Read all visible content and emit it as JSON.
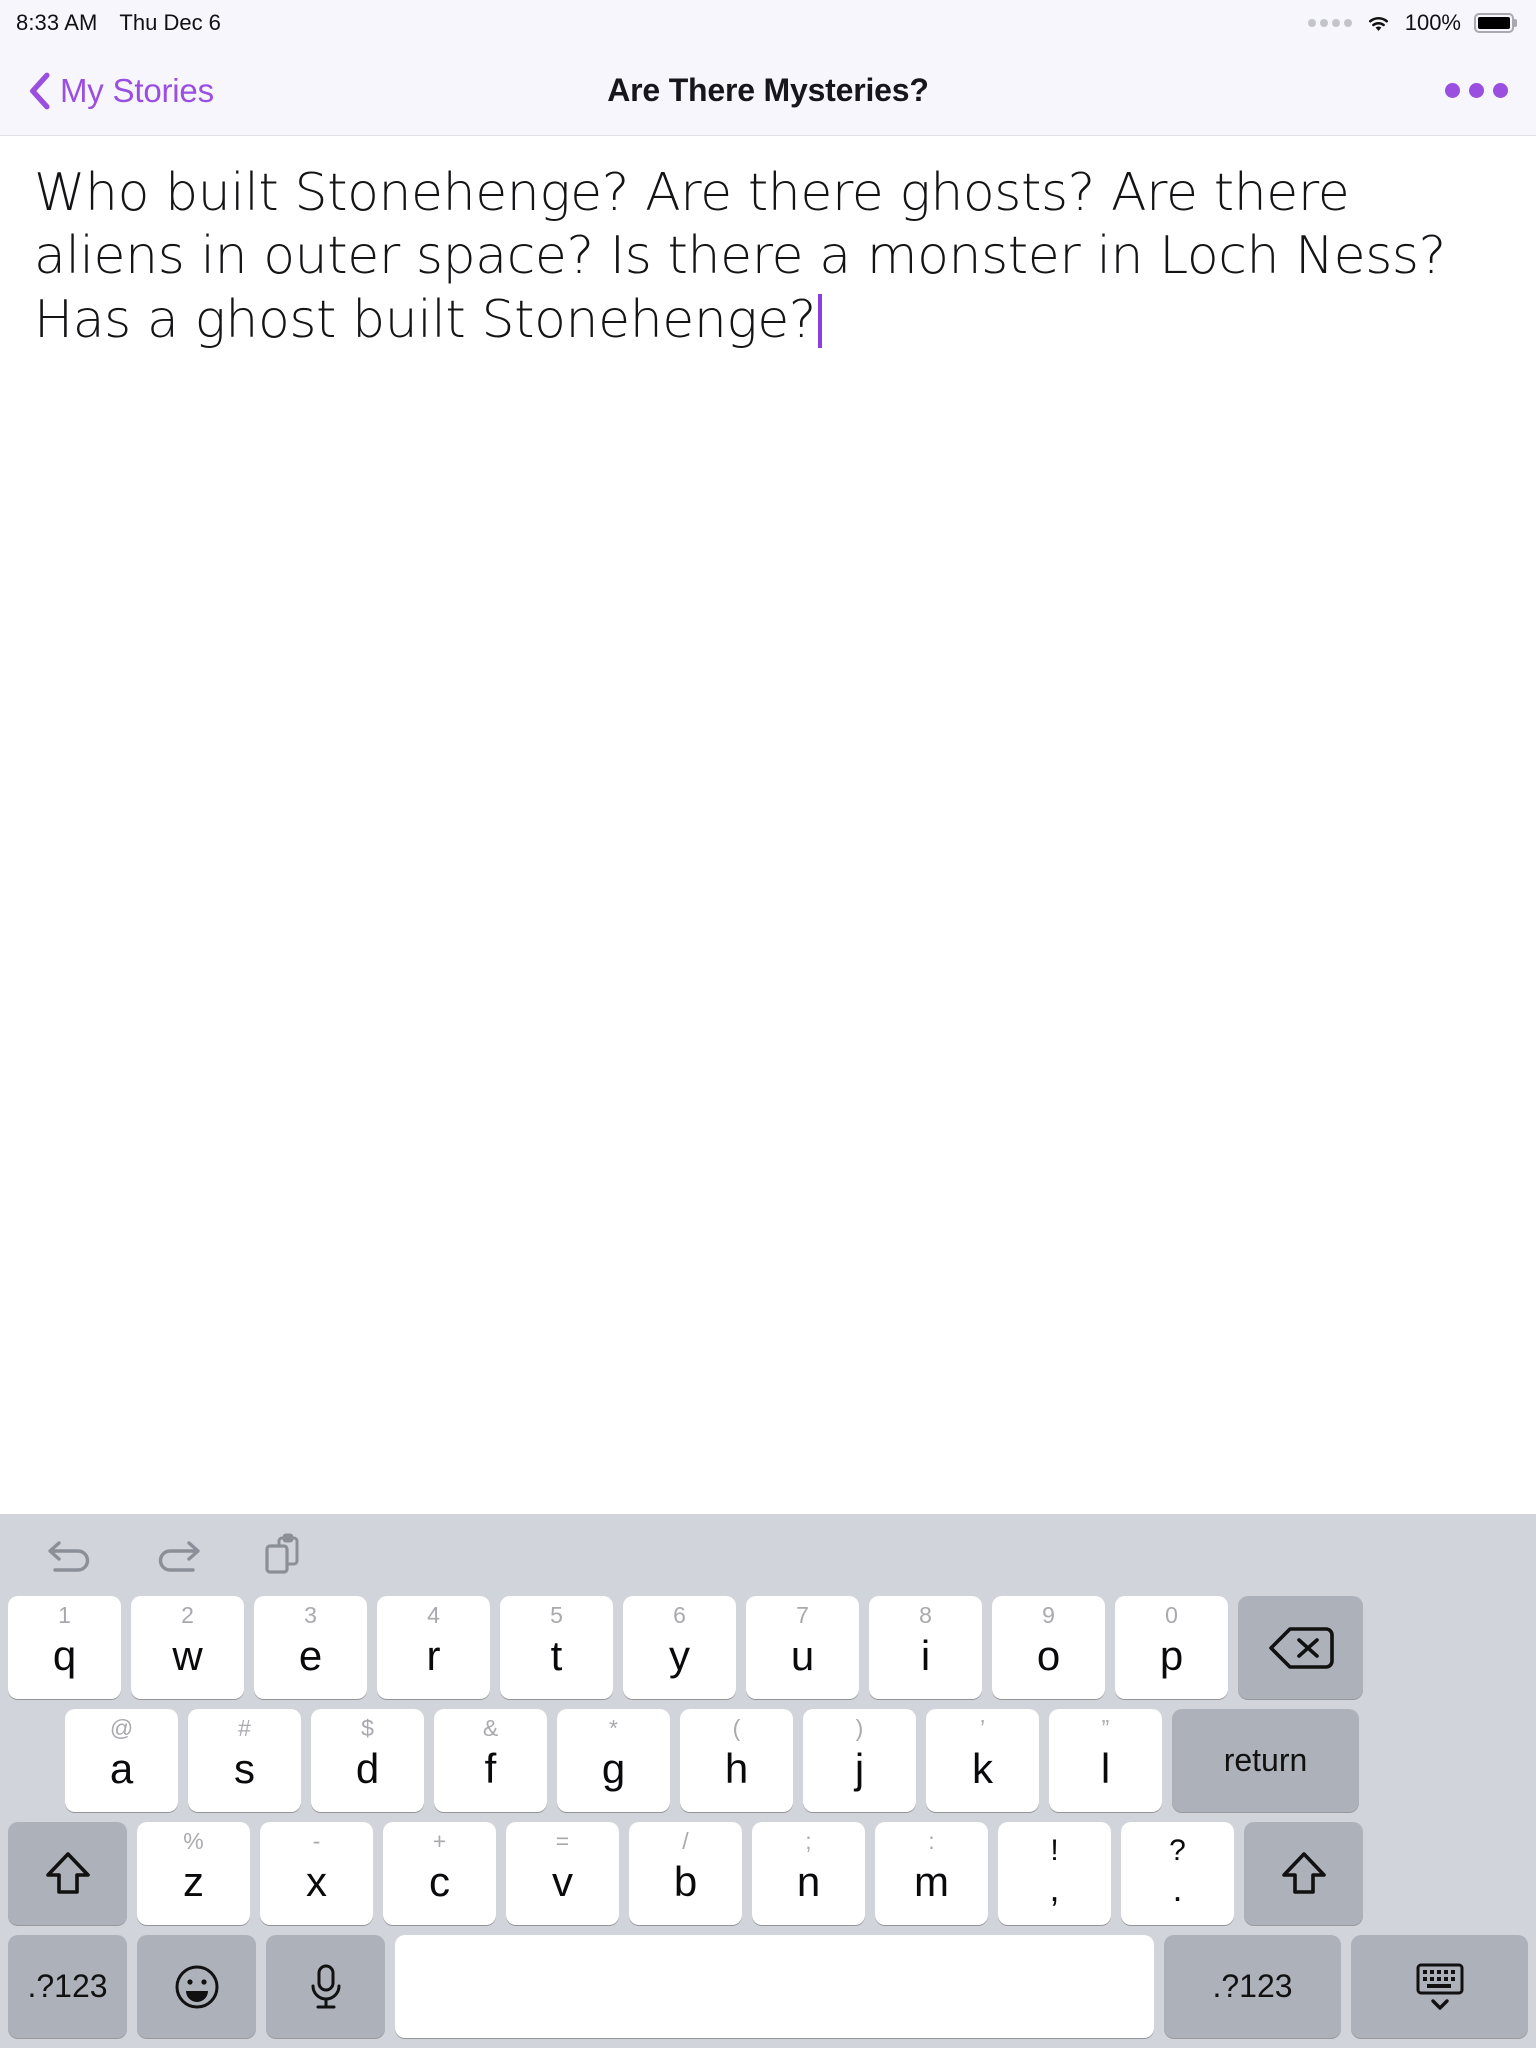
{
  "status_bar": {
    "time": "8:33 AM",
    "date": "Thu Dec 6",
    "battery_percent": "100%",
    "signal_icon": "signal-dots-icon",
    "wifi_icon": "wifi-icon",
    "battery_icon": "battery-full-icon"
  },
  "nav_bar": {
    "back_label": "My Stories",
    "back_icon": "chevron-left-icon",
    "title": "Are There Mysteries?",
    "more_icon": "more-horizontal-icon",
    "accent_color": "#9a4fe0"
  },
  "editor": {
    "story_text": "Who built Stonehenge? Are there ghosts? Are there aliens in outer space? Is there a monster in Loch Ness? Has a ghost built Stonehenge?",
    "caret_color": "#8b3fe0"
  },
  "keyboard": {
    "toolbar": [
      {
        "name": "undo-icon",
        "label": "undo"
      },
      {
        "name": "redo-icon",
        "label": "redo"
      },
      {
        "name": "paste-icon",
        "label": "paste"
      }
    ],
    "row1": [
      {
        "sub": "1",
        "main": "q"
      },
      {
        "sub": "2",
        "main": "w"
      },
      {
        "sub": "3",
        "main": "e"
      },
      {
        "sub": "4",
        "main": "r"
      },
      {
        "sub": "5",
        "main": "t"
      },
      {
        "sub": "6",
        "main": "y"
      },
      {
        "sub": "7",
        "main": "u"
      },
      {
        "sub": "8",
        "main": "i"
      },
      {
        "sub": "9",
        "main": "o"
      },
      {
        "sub": "0",
        "main": "p"
      }
    ],
    "backspace_icon": "backspace-icon",
    "row2": [
      {
        "sub": "@",
        "main": "a"
      },
      {
        "sub": "#",
        "main": "s"
      },
      {
        "sub": "$",
        "main": "d"
      },
      {
        "sub": "&",
        "main": "f"
      },
      {
        "sub": "*",
        "main": "g"
      },
      {
        "sub": "(",
        "main": "h"
      },
      {
        "sub": ")",
        "main": "j"
      },
      {
        "sub": "’",
        "main": "k"
      },
      {
        "sub": "”",
        "main": "l"
      }
    ],
    "return_label": "return",
    "row3": [
      {
        "sub": "%",
        "main": "z"
      },
      {
        "sub": "-",
        "main": "x"
      },
      {
        "sub": "+",
        "main": "c"
      },
      {
        "sub": "=",
        "main": "v"
      },
      {
        "sub": "/",
        "main": "b"
      },
      {
        "sub": ";",
        "main": "n"
      },
      {
        "sub": ":",
        "main": "m"
      },
      {
        "sub": "!",
        "main": ","
      },
      {
        "sub": "?",
        "main": "."
      }
    ],
    "shift_icon": "shift-icon",
    "row4": {
      "mode_left_label": ".?123",
      "emoji_icon": "emoji-smiley-icon",
      "mic_icon": "microphone-icon",
      "space_label": "",
      "mode_right_label": ".?123",
      "dismiss_icon": "dismiss-keyboard-icon"
    }
  }
}
